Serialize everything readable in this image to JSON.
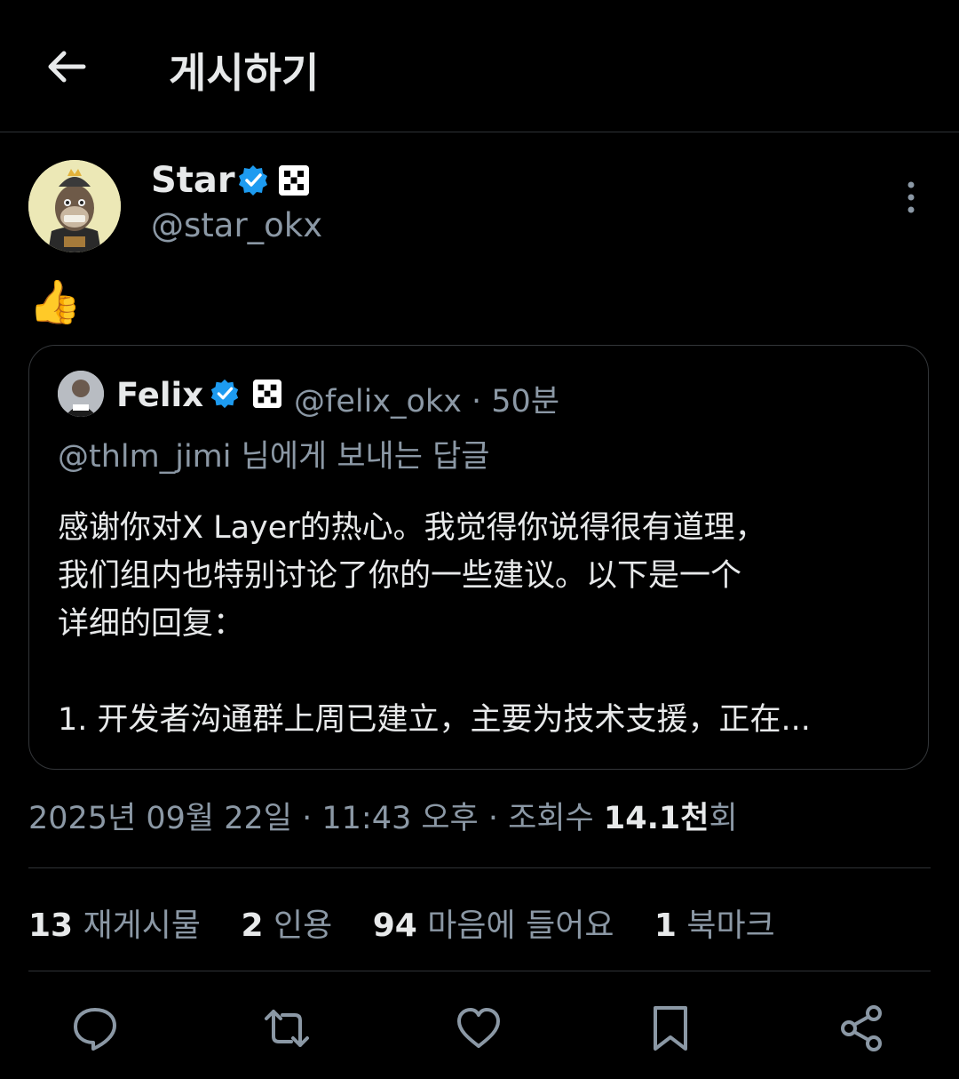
{
  "header": {
    "title": "게시하기"
  },
  "post": {
    "author_name": "Star",
    "author_handle": "@star_okx",
    "text_emoji": "👍",
    "timestamp": "2025년 09월 22일 · 11:43 오후 · 조회수 ",
    "views_number": "14.1천",
    "views_suffix": "회"
  },
  "quote": {
    "author_name": "Felix",
    "meta": "@felix_okx · 50분",
    "reply_to": "@thlm_jimi 님에게 보내는 답글",
    "lines": [
      "感谢你对X Layer的热心。我觉得你说得很有道理，",
      "我们组内也特别讨论了你的一些建议。以下是一个",
      "详细的回复：",
      "",
      "1. 开发者沟通群上周已建立，主要为技术支援，正在..."
    ]
  },
  "stats": [
    {
      "number": "13",
      "label": "재게시물"
    },
    {
      "number": "2",
      "label": "인용"
    },
    {
      "number": "94",
      "label": "마음에 들어요"
    },
    {
      "number": "1",
      "label": "북마크"
    }
  ],
  "colors": {
    "background": "#000000",
    "muted": "#8b98a5",
    "verified": "#1d9bf0",
    "divider": "#2f3336"
  },
  "icons": [
    "back-arrow-icon",
    "verified-badge-icon",
    "okx-badge-icon",
    "more-vertical-icon",
    "reply-icon",
    "repost-icon",
    "like-icon",
    "bookmark-icon",
    "share-icon"
  ]
}
